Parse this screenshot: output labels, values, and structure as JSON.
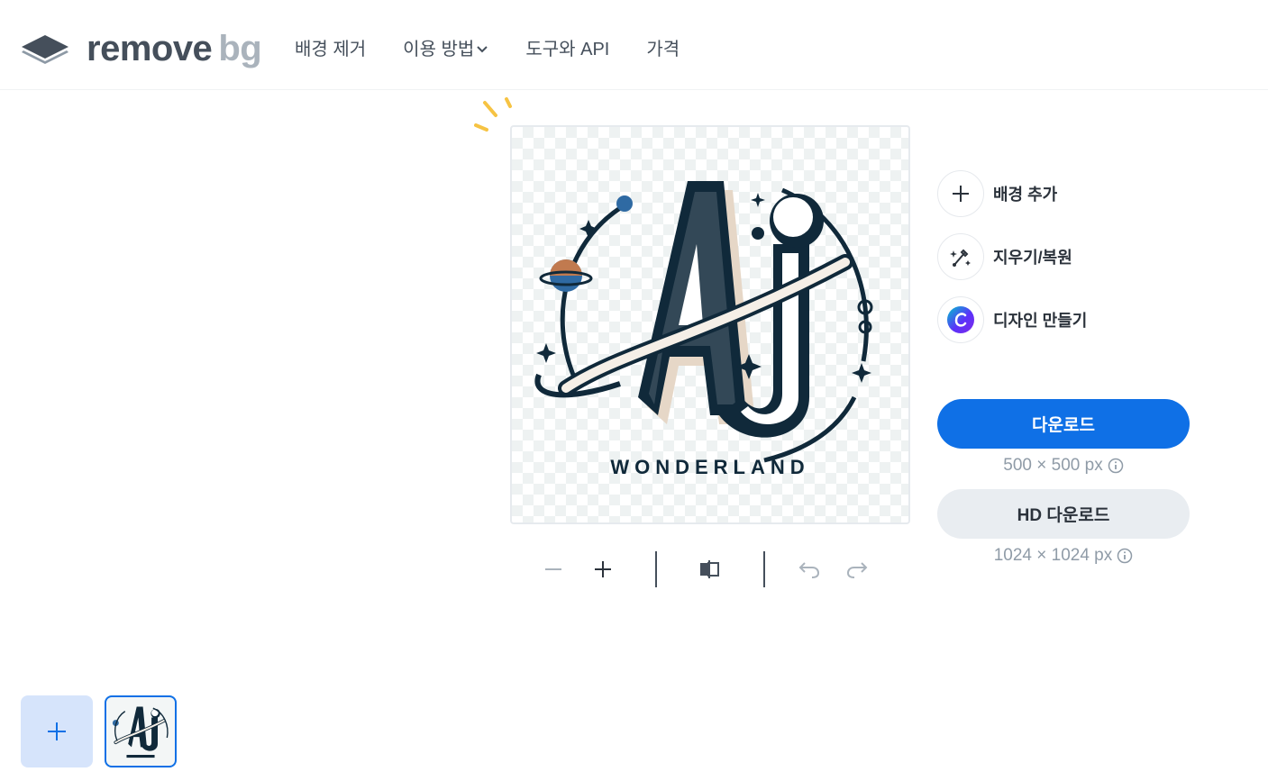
{
  "header": {
    "logo": {
      "word1": "remove",
      "word2": "bg",
      "icon": "layers-logo-icon"
    },
    "nav": [
      {
        "label": "배경 제거",
        "has_dropdown": false
      },
      {
        "label": "이용 방법",
        "has_dropdown": true
      },
      {
        "label": "도구와 API",
        "has_dropdown": false
      },
      {
        "label": "가격",
        "has_dropdown": false
      }
    ]
  },
  "preview": {
    "image_text": {
      "monogram": "AJ",
      "caption": "WONDERLAND"
    },
    "transparent_background": true
  },
  "toolbar": {
    "icons": [
      "zoom-out-icon",
      "zoom-in-icon",
      "compare-icon",
      "undo-icon",
      "redo-icon"
    ]
  },
  "side_actions": [
    {
      "label": "배경 추가",
      "icon": "plus-icon"
    },
    {
      "label": "지우기/복원",
      "icon": "magic-brush-icon"
    },
    {
      "label": "디자인 만들기",
      "icon": "canva-logo-icon"
    }
  ],
  "download": {
    "primary_label": "다운로드",
    "primary_resolution": "500 × 500 px",
    "hd_label": "HD 다운로드",
    "hd_resolution": "1024 × 1024 px"
  },
  "colors": {
    "accent": "#0f70e6",
    "text": "#454f5b",
    "muted": "#8f9ba7",
    "add_tile": "#d6e4fb"
  }
}
